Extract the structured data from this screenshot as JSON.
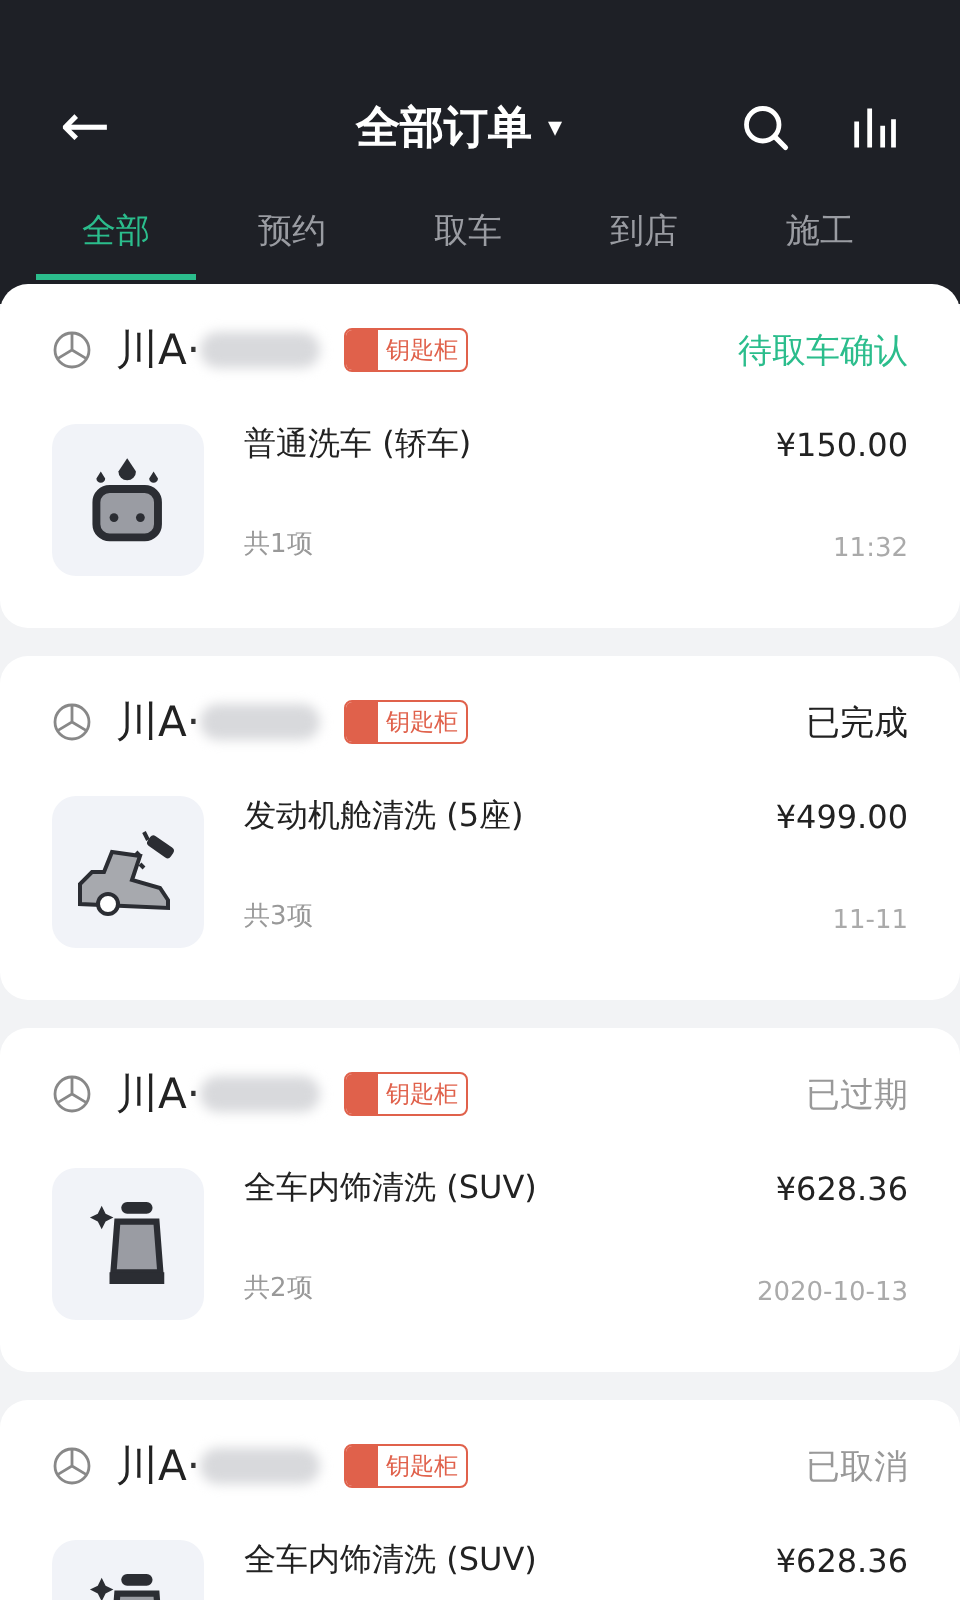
{
  "header": {
    "back": "←",
    "title": "全部订单",
    "dropdown": "▾"
  },
  "tabs": [
    {
      "label": "全部",
      "selected": true
    },
    {
      "label": "预约",
      "selected": false
    },
    {
      "label": "取车",
      "selected": false
    },
    {
      "label": "到店",
      "selected": false
    },
    {
      "label": "施工",
      "selected": false
    }
  ],
  "orders": [
    {
      "plate": "川A·",
      "tag": "钥匙柜",
      "status": {
        "text": "待取车确认",
        "kind": "pending"
      },
      "kind": "wash",
      "service": "普通洗车 (轿车)",
      "price": "¥150.00",
      "count": "共1项",
      "time": "11:32"
    },
    {
      "plate": "川A·",
      "tag": "钥匙柜",
      "status": {
        "text": "已完成",
        "kind": "done"
      },
      "kind": "engine",
      "service": "发动机舱清洗 (5座)",
      "price": "¥499.00",
      "count": "共3项",
      "time": "11-11"
    },
    {
      "plate": "川A·",
      "tag": "钥匙柜",
      "status": {
        "text": "已过期",
        "kind": "inactive"
      },
      "kind": "seat",
      "service": "全车内饰清洗 (SUV)",
      "price": "¥628.36",
      "count": "共2项",
      "time": "2020-10-13"
    },
    {
      "plate": "川A·",
      "tag": "钥匙柜",
      "status": {
        "text": "已取消",
        "kind": "inactive"
      },
      "kind": "seat",
      "service": "全车内饰清洗 (SUV)",
      "price": "¥628.36"
    }
  ]
}
